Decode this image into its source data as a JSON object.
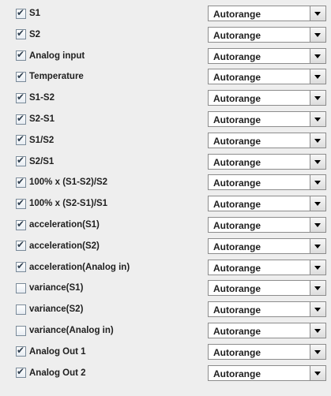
{
  "rows": [
    {
      "label": "S1",
      "checked": true,
      "range": "Autorange"
    },
    {
      "label": "S2",
      "checked": true,
      "range": "Autorange"
    },
    {
      "label": "Analog input",
      "checked": true,
      "range": "Autorange"
    },
    {
      "label": "Temperature",
      "checked": true,
      "range": "Autorange"
    },
    {
      "label": "S1-S2",
      "checked": true,
      "range": "Autorange"
    },
    {
      "label": "S2-S1",
      "checked": true,
      "range": "Autorange"
    },
    {
      "label": "S1/S2",
      "checked": true,
      "range": "Autorange"
    },
    {
      "label": "S2/S1",
      "checked": true,
      "range": "Autorange"
    },
    {
      "label": "100% x (S1-S2)/S2",
      "checked": true,
      "range": "Autorange"
    },
    {
      "label": "100% x (S2-S1)/S1",
      "checked": true,
      "range": "Autorange"
    },
    {
      "label": "acceleration(S1)",
      "checked": true,
      "range": "Autorange"
    },
    {
      "label": "acceleration(S2)",
      "checked": true,
      "range": "Autorange"
    },
    {
      "label": "acceleration(Analog in)",
      "checked": true,
      "range": "Autorange"
    },
    {
      "label": "variance(S1)",
      "checked": false,
      "range": "Autorange"
    },
    {
      "label": "variance(S2)",
      "checked": false,
      "range": "Autorange"
    },
    {
      "label": "variance(Analog in)",
      "checked": false,
      "range": "Autorange"
    },
    {
      "label": "Analog Out 1",
      "checked": true,
      "range": "Autorange"
    },
    {
      "label": "Analog Out 2",
      "checked": true,
      "range": "Autorange"
    }
  ],
  "icons": {
    "checkbox": "checkbox-icon",
    "dropdown": "chevron-down-icon"
  },
  "colors": {
    "background": "#eeeeee",
    "field_border": "#8c8c8c",
    "text": "#1f1f1f"
  }
}
